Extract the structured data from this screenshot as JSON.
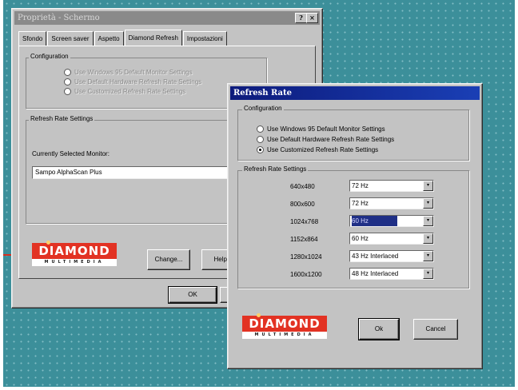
{
  "back_window": {
    "title": "Proprietà - Schermo",
    "tabs": [
      "Sfondo",
      "Screen saver",
      "Aspetto",
      "Diamond Refresh",
      "Impostazioni"
    ],
    "selected_tab": "Diamond Refresh",
    "config_label": "Configuration",
    "config_options": [
      "Use Windows 95 Default Monitor Settings",
      "Use Default Hardware Refresh Rate Settings",
      "Use Customized Refresh Rate Settings"
    ],
    "refresh_label": "Refresh Rate Settings",
    "monitor_label": "Currently Selected Monitor:",
    "monitor_value": "Sampo AlphaScan Plus",
    "change_button": "Change...",
    "help_button": "Help...",
    "ok_button": "OK",
    "close_glyph": "×",
    "help_glyph": "?"
  },
  "front_window": {
    "title": "Refresh Rate",
    "config_label": "Configuration",
    "config_options": [
      {
        "label": "Use Windows 95 Default Monitor Settings",
        "selected": false
      },
      {
        "label": "Use Default Hardware Refresh Rate Settings",
        "selected": false
      },
      {
        "label": "Use Customized Refresh Rate Settings",
        "selected": true
      }
    ],
    "refresh_label": "Refresh Rate Settings",
    "rows": [
      {
        "resolution": "640x480",
        "rate": "72 Hz",
        "highlighted": false
      },
      {
        "resolution": "800x600",
        "rate": "72 Hz",
        "highlighted": false
      },
      {
        "resolution": "1024x768",
        "rate": "60 Hz",
        "highlighted": true
      },
      {
        "resolution": "1152x864",
        "rate": "60 Hz",
        "highlighted": false
      },
      {
        "resolution": "1280x1024",
        "rate": "43 Hz Interlaced",
        "highlighted": false
      },
      {
        "resolution": "1600x1200",
        "rate": "48 Hz Interlaced",
        "highlighted": false
      }
    ],
    "ok_button": "Ok",
    "cancel_button": "Cancel"
  },
  "logo": {
    "name": "DIAMOND",
    "subtitle": "MULTIMEDIA"
  },
  "colors": {
    "desktop": "#3c8f9a",
    "active_title": "#0d1b7c",
    "logo_red": "#e23223",
    "selection": "#1f2f86"
  },
  "icons": {
    "dropdown": "▾",
    "radio": "radio-button"
  }
}
